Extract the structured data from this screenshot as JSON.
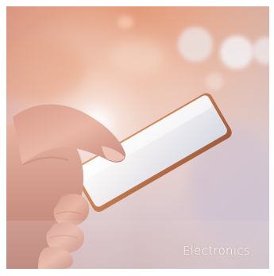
{
  "category_tile": {
    "caption": "Electronics",
    "image_subject": "hand-holding-smartphone-photo"
  }
}
